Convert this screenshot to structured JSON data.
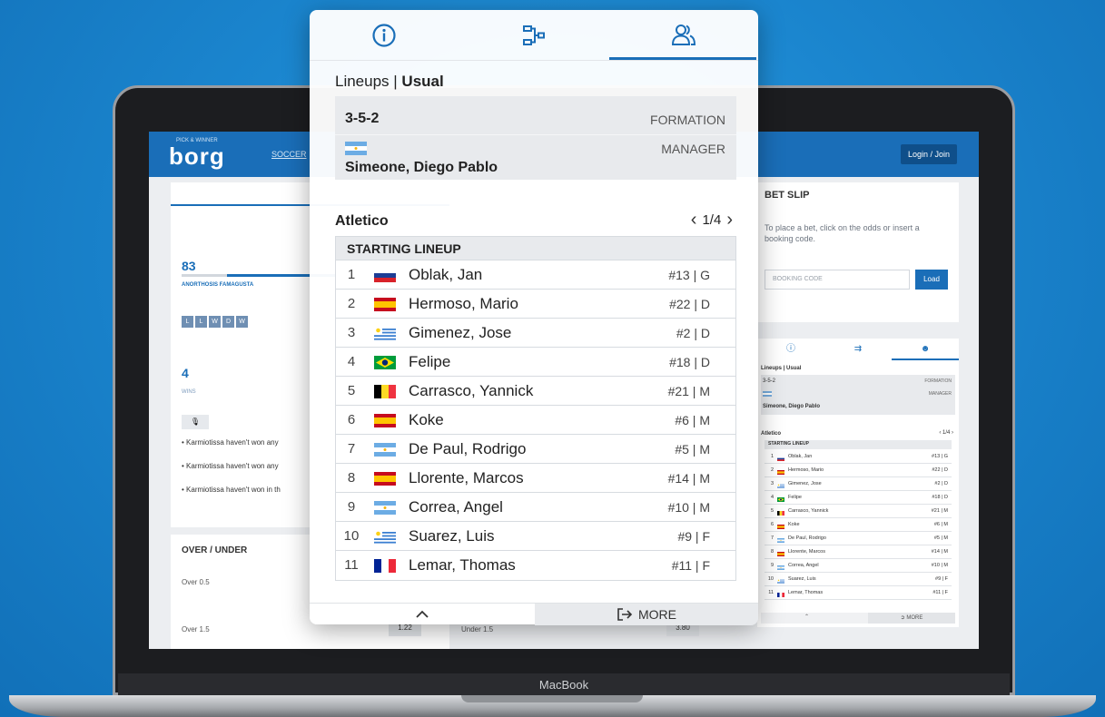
{
  "laptop": {
    "brand": "MacBook"
  },
  "site": {
    "logo": "borg",
    "logo_tag": "PICK & WINNER",
    "nav_soccer": "SOCCER",
    "login_label": "Login / Join",
    "stats": {
      "score": "83",
      "team": "ANORTHOSIS FAMAGUSTA",
      "form": [
        "L",
        "L",
        "W",
        "D",
        "W"
      ],
      "wins": "4",
      "wins_label": "WINS",
      "facts": [
        "Karmiotissa haven't won any",
        "Karmiotissa haven't won any",
        "Karmiotissa haven't won in th"
      ]
    },
    "over_under": {
      "title": "OVER / UNDER",
      "rows": [
        {
          "label": "Over 0.5"
        },
        {
          "label": "Over 1.5",
          "odd": "1.22",
          "under_label": "Under 1.5",
          "under_odd": "3.80"
        }
      ]
    },
    "bet_slip": {
      "title": "BET SLIP",
      "text": "To place a bet, click on the odds or insert a booking code.",
      "booking_placeholder": "BOOKING CODE",
      "load_label": "Load"
    }
  },
  "panel": {
    "tabs": [
      {
        "name": "info",
        "icon": "info-icon"
      },
      {
        "name": "formation",
        "icon": "formation-icon"
      },
      {
        "name": "lineups",
        "icon": "players-icon",
        "active": true
      }
    ],
    "section_title_prefix": "Lineups | ",
    "section_title_bold": "Usual",
    "formation": {
      "value": "3-5-2",
      "label": "FORMATION"
    },
    "manager": {
      "label": "MANAGER",
      "name": "Simeone, Diego Pablo",
      "flag": "argentina"
    },
    "team": {
      "name": "Atletico",
      "page": "1/4"
    },
    "lineup_header": "STARTING LINEUP",
    "players": [
      {
        "num": "1",
        "flag": "slovenia",
        "name": "Oblak, Jan",
        "pos": "#13 | G"
      },
      {
        "num": "2",
        "flag": "spain",
        "name": "Hermoso, Mario",
        "pos": "#22 | D"
      },
      {
        "num": "3",
        "flag": "uruguay",
        "name": "Gimenez, Jose",
        "pos": "#2 | D"
      },
      {
        "num": "4",
        "flag": "brazil",
        "name": "Felipe",
        "pos": "#18 | D"
      },
      {
        "num": "5",
        "flag": "belgium",
        "name": "Carrasco, Yannick",
        "pos": "#21 | M"
      },
      {
        "num": "6",
        "flag": "spain",
        "name": "Koke",
        "pos": "#6 | M"
      },
      {
        "num": "7",
        "flag": "argentina",
        "name": "De Paul, Rodrigo",
        "pos": "#5 | M"
      },
      {
        "num": "8",
        "flag": "spain",
        "name": "Llorente, Marcos",
        "pos": "#14 | M"
      },
      {
        "num": "9",
        "flag": "argentina",
        "name": "Correa, Angel",
        "pos": "#10 | M"
      },
      {
        "num": "10",
        "flag": "uruguay",
        "name": "Suarez, Luis",
        "pos": "#9 | F"
      },
      {
        "num": "11",
        "flag": "france",
        "name": "Lemar, Thomas",
        "pos": "#11 | F"
      }
    ],
    "more_label": "MORE"
  },
  "colors": {
    "accent": "#1a6eb8",
    "background": "#1b86cf"
  }
}
